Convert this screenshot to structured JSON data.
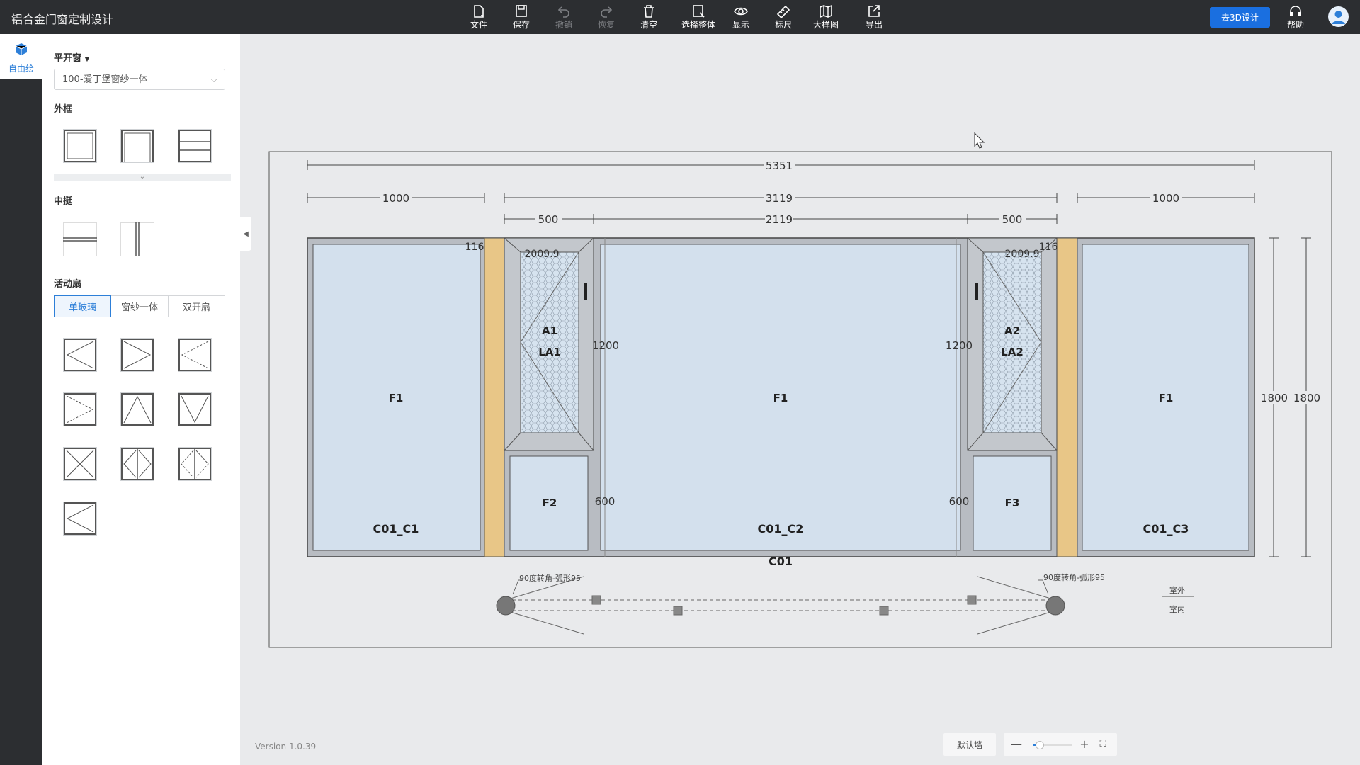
{
  "app": {
    "title": "铝合金门窗定制设计"
  },
  "toolbar": {
    "items": [
      {
        "label": "文件",
        "icon": "file-icon",
        "enabled": true
      },
      {
        "label": "保存",
        "icon": "save-icon",
        "enabled": true
      },
      {
        "label": "撤销",
        "icon": "undo-icon",
        "enabled": false
      },
      {
        "label": "恢复",
        "icon": "redo-icon",
        "enabled": false
      },
      {
        "label": "清空",
        "icon": "trash-icon",
        "enabled": true
      },
      {
        "label": "选择整体",
        "icon": "select-all-icon",
        "enabled": true
      },
      {
        "label": "显示",
        "icon": "eye-icon",
        "enabled": true
      },
      {
        "label": "标尺",
        "icon": "ruler-icon",
        "enabled": true
      },
      {
        "label": "大样图",
        "icon": "map-icon",
        "enabled": true
      },
      {
        "label": "导出",
        "icon": "export-icon",
        "enabled": true
      }
    ],
    "go3d": "去3D设计",
    "help": "帮助"
  },
  "rail": {
    "item_label": "自由绘"
  },
  "panel": {
    "category": "平开窗",
    "series_value": "100-爱丁堡窗纱一体",
    "outer_frame_title": "外框",
    "mullion_title": "中挺",
    "sash_title": "活动扇",
    "sash_tabs": [
      "单玻璃",
      "窗纱一体",
      "双开扇"
    ],
    "active_tab": 0
  },
  "drawing": {
    "dims_top": {
      "total": "5351",
      "left": "1000",
      "middle": "3119",
      "right": "1000",
      "sub_left": "500",
      "sub_middle": "2119",
      "sub_right": "500"
    },
    "dims_side": [
      "1800",
      "1800"
    ],
    "labels": {
      "p1": "F1",
      "p1_name": "C01_C1",
      "p2": "F1",
      "p2_name": "C01_C2",
      "p3": "F1",
      "p3_name": "C01_C3",
      "a1": "A1",
      "la1": "LA1",
      "a2": "A2",
      "la2": "LA2",
      "f2": "F2",
      "f3": "F3",
      "window_name": "C01",
      "h1200_left": "1200",
      "h1200_right": "1200",
      "h600_left": "600",
      "h600_right": "600",
      "w2009_left": "2009.9",
      "w2009_right": "2009.9",
      "n116_left": "116",
      "n116_right": "116"
    },
    "plan": {
      "corner_left": "90度转角-弧形95",
      "corner_right": "90度转角-弧形95",
      "outside": "室外",
      "inside": "室内"
    }
  },
  "footer": {
    "version": "Version 1.0.39",
    "wall": "默认墙",
    "zoom_level": 0.15
  },
  "colors": {
    "accent": "#1a6fe0",
    "glass": "#d3e0ed",
    "mullion": "#e8c687",
    "frame": "#b8bcc2"
  }
}
